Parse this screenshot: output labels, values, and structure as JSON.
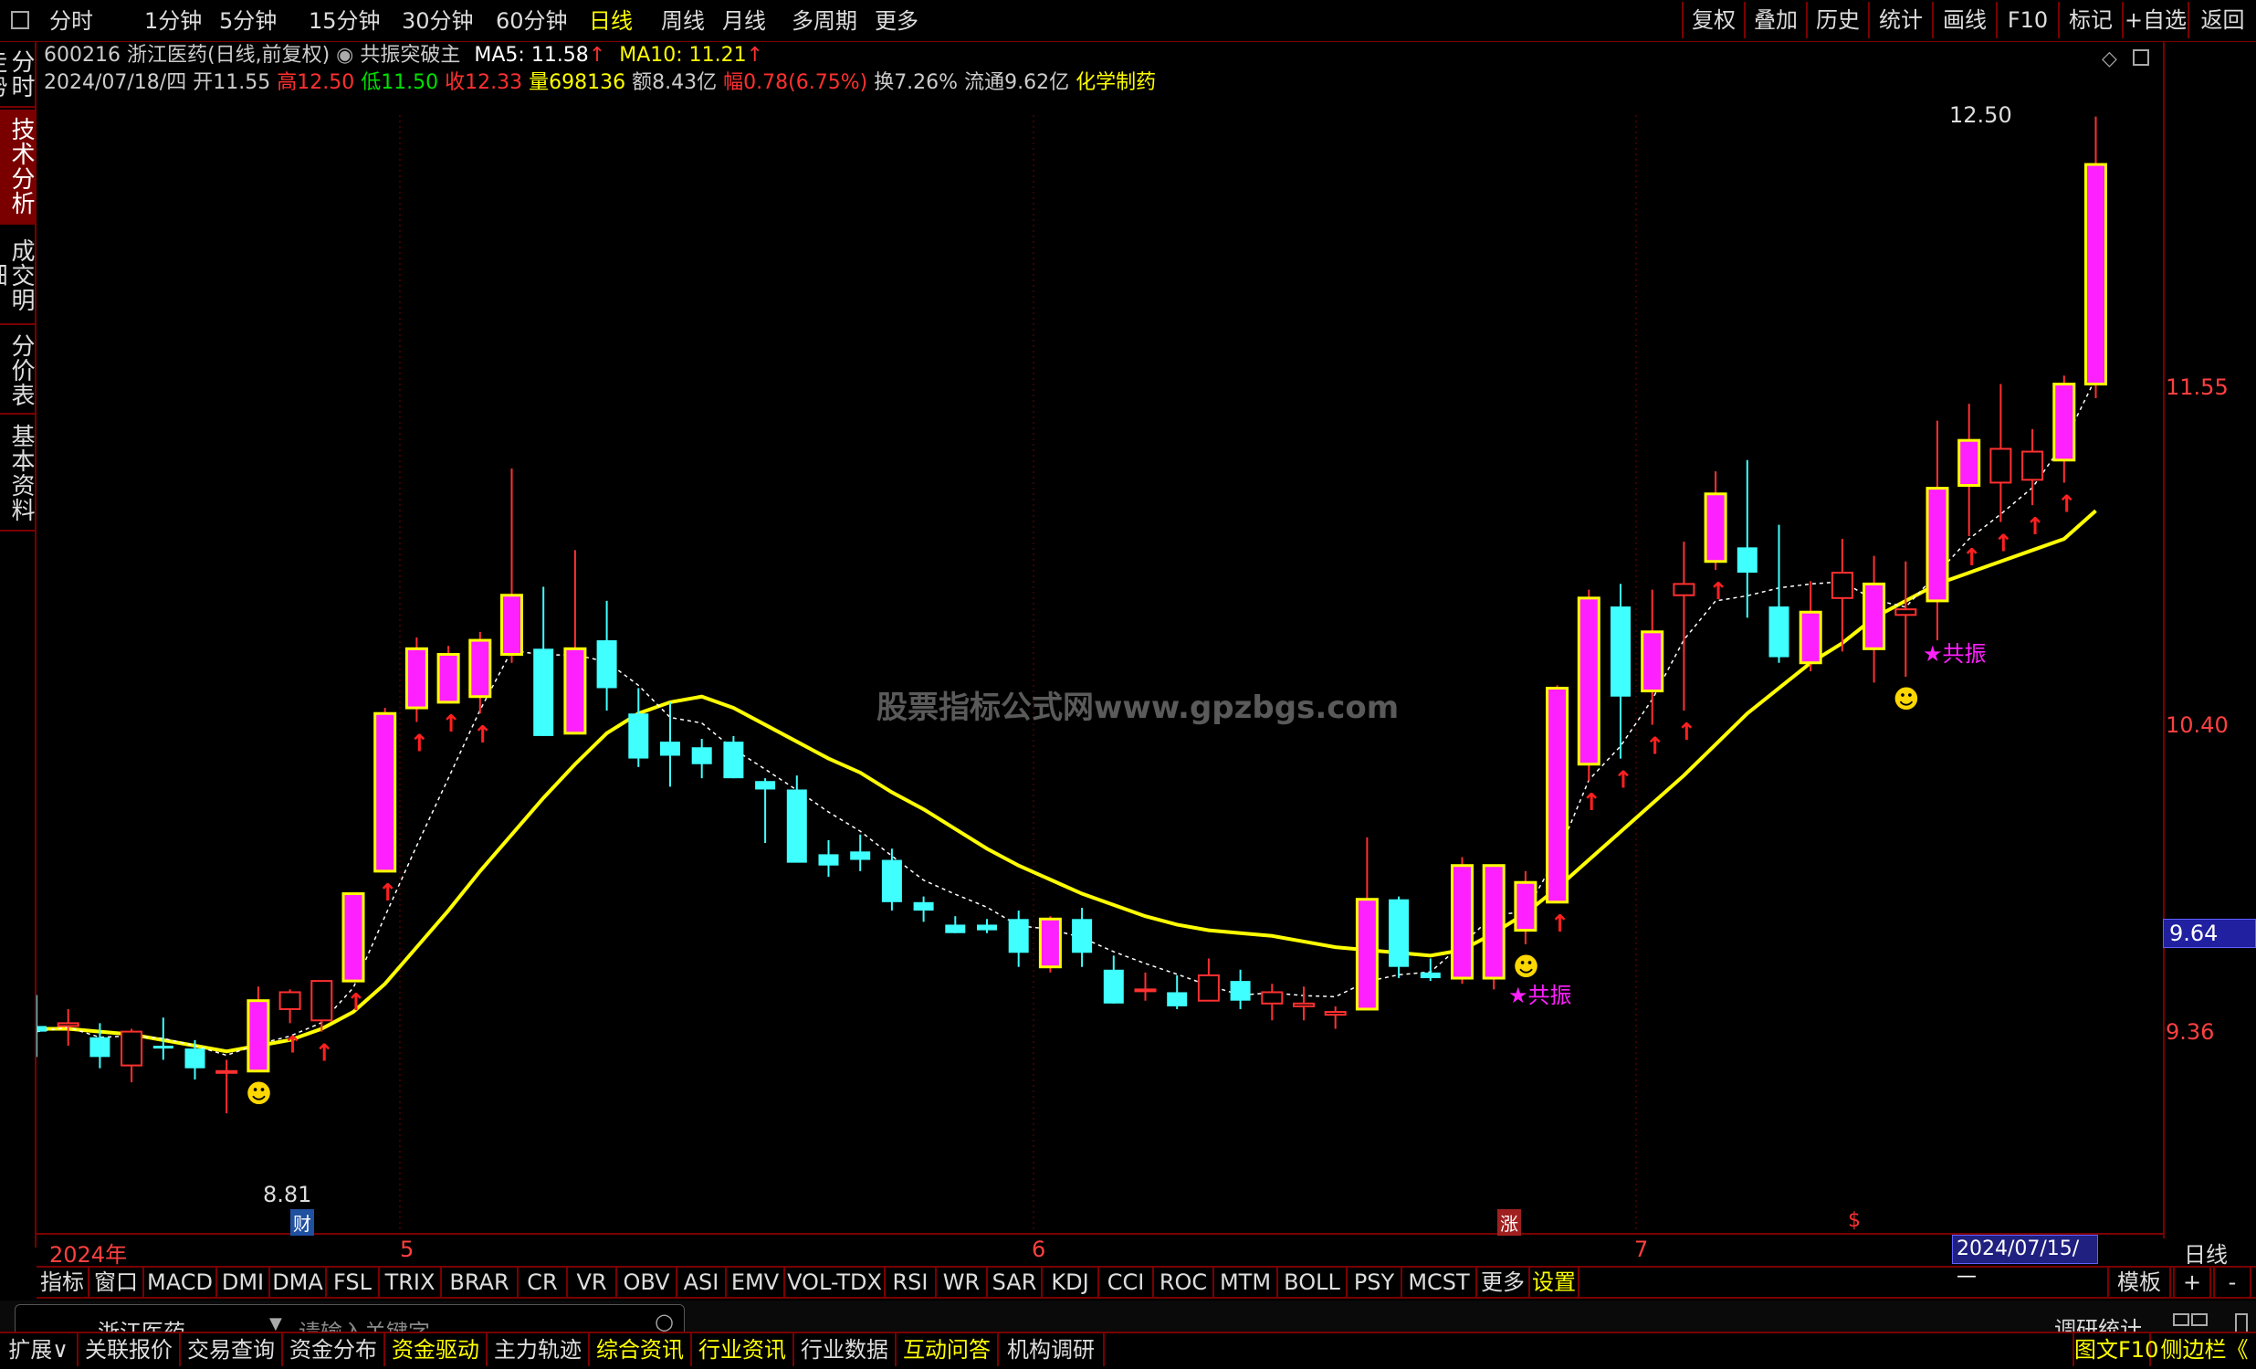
{
  "toolbar": {
    "periods": [
      "分时",
      "1分钟",
      "5分钟",
      "15分钟",
      "30分钟",
      "60分钟",
      "日线",
      "周线",
      "月线",
      "多周期",
      "更多"
    ],
    "active_period": "日线",
    "right_buttons": [
      "复权",
      "叠加",
      "历史",
      "统计",
      "画线",
      "F10",
      "标记",
      "+自选",
      "返回"
    ]
  },
  "left_tabs": [
    "分时走势",
    "技术分析",
    "成交明细",
    "分价表",
    "基本资料"
  ],
  "stock": {
    "code": "600216",
    "name": "浙江医药",
    "mode": "(日线,前复权)",
    "indicator_name": "共振突破主",
    "ma5_label": "MA5: 11.58",
    "ma10_label": "MA10: 11.21",
    "date": "2024/07/18/四",
    "open_label": "开11.55",
    "high_label": "高12.50",
    "low_label": "低11.50",
    "close_label": "收12.33",
    "volume_label": "量698136",
    "amount_label": "额8.43亿",
    "change_label": "幅0.78(6.75%)",
    "turnover_label": "换7.26%",
    "float_label": "流通9.62亿",
    "sector": "化学制药"
  },
  "price_axis": {
    "labels": [
      "11.55",
      "10.40",
      "9.36"
    ],
    "current_price_box": "9.64",
    "unit_label": "日线"
  },
  "date_axis": {
    "labels": [
      "2024年",
      "5",
      "6",
      "7"
    ],
    "cursor_date": "2024/07/15/—",
    "markers": {
      "cai": "财",
      "zhang": "涨",
      "dollar": "$"
    }
  },
  "annotations": {
    "high_price": "12.50",
    "low_price": "8.81",
    "gongzhen": "★共振",
    "watermark": "股票指标公式网www.gpzbgs.com"
  },
  "indicator_tabs": [
    "指标",
    "窗口",
    "MACD",
    "DMI",
    "DMA",
    "FSL",
    "TRIX",
    "BRAR",
    "CR",
    "VR",
    "OBV",
    "ASI",
    "EMV",
    "VOL-TDX",
    "RSI",
    "WR",
    "SAR",
    "KDJ",
    "CCI",
    "ROC",
    "MTM",
    "BOLL",
    "PSY",
    "MCST",
    "更多",
    "设置"
  ],
  "indicator_tabs_right": [
    "模板",
    "+",
    "-"
  ],
  "search": {
    "stock_name": "浙江医药",
    "placeholder": "请输入关键字",
    "right_label": "调研统计"
  },
  "bottom_tabs": [
    "扩展∨",
    "关联报价",
    "交易查询",
    "资金分布",
    "资金驱动",
    "主力轨迹",
    "综合资讯",
    "行业资讯",
    "行业数据",
    "互动问答",
    "机构调研"
  ],
  "bottom_right": [
    "图文F10",
    "侧边栏《"
  ],
  "colors": {
    "up": "#ff3030",
    "down": "#40ffff",
    "ma_line": "#ffff00",
    "accent_magenta": "#ff20ff",
    "border": "#7a0000"
  },
  "chart_data": {
    "type": "candlestick",
    "ylim": [
      8.6,
      12.7
    ],
    "series_ma": "MA10",
    "candles": [
      {
        "o": 9.27,
        "h": 9.38,
        "l": 9.16,
        "c": 9.25
      },
      {
        "o": 9.27,
        "h": 9.33,
        "l": 9.2,
        "c": 9.28
      },
      {
        "o": 9.23,
        "h": 9.28,
        "l": 9.12,
        "c": 9.16
      },
      {
        "o": 9.13,
        "h": 9.26,
        "l": 9.07,
        "c": 9.25
      },
      {
        "o": 9.2,
        "h": 9.3,
        "l": 9.15,
        "c": 9.19
      },
      {
        "o": 9.19,
        "h": 9.22,
        "l": 9.08,
        "c": 9.12
      },
      {
        "o": 9.11,
        "h": 9.15,
        "l": 8.96,
        "c": 9.11
      },
      {
        "o": 9.11,
        "h": 9.41,
        "l": 9.11,
        "c": 9.36
      },
      {
        "o": 9.33,
        "h": 9.4,
        "l": 9.28,
        "c": 9.39
      },
      {
        "o": 9.29,
        "h": 9.43,
        "l": 9.25,
        "c": 9.43
      },
      {
        "o": 9.43,
        "h": 9.74,
        "l": 9.43,
        "c": 9.74
      },
      {
        "o": 9.82,
        "h": 10.4,
        "l": 9.82,
        "c": 10.38
      },
      {
        "o": 10.4,
        "h": 10.65,
        "l": 10.35,
        "c": 10.61
      },
      {
        "o": 10.42,
        "h": 10.62,
        "l": 10.42,
        "c": 10.59
      },
      {
        "o": 10.44,
        "h": 10.67,
        "l": 10.38,
        "c": 10.64
      },
      {
        "o": 10.59,
        "h": 11.25,
        "l": 10.56,
        "c": 10.8
      },
      {
        "o": 10.61,
        "h": 10.83,
        "l": 10.3,
        "c": 10.3
      },
      {
        "o": 10.31,
        "h": 10.96,
        "l": 10.31,
        "c": 10.61
      },
      {
        "o": 10.64,
        "h": 10.78,
        "l": 10.39,
        "c": 10.47
      },
      {
        "o": 10.38,
        "h": 10.47,
        "l": 10.19,
        "c": 10.22
      },
      {
        "o": 10.28,
        "h": 10.42,
        "l": 10.12,
        "c": 10.23
      },
      {
        "o": 10.26,
        "h": 10.29,
        "l": 10.15,
        "c": 10.2
      },
      {
        "o": 10.28,
        "h": 10.3,
        "l": 10.15,
        "c": 10.15
      },
      {
        "o": 10.14,
        "h": 10.15,
        "l": 9.92,
        "c": 10.11
      },
      {
        "o": 10.11,
        "h": 10.16,
        "l": 9.87,
        "c": 9.85
      },
      {
        "o": 9.88,
        "h": 9.93,
        "l": 9.8,
        "c": 9.84
      },
      {
        "o": 9.89,
        "h": 9.95,
        "l": 9.82,
        "c": 9.86
      },
      {
        "o": 9.86,
        "h": 9.9,
        "l": 9.68,
        "c": 9.71
      },
      {
        "o": 9.71,
        "h": 9.73,
        "l": 9.64,
        "c": 9.68
      },
      {
        "o": 9.63,
        "h": 9.66,
        "l": 9.6,
        "c": 9.6
      },
      {
        "o": 9.63,
        "h": 9.65,
        "l": 9.6,
        "c": 9.61
      },
      {
        "o": 9.65,
        "h": 9.68,
        "l": 9.48,
        "c": 9.53
      },
      {
        "o": 9.48,
        "h": 9.66,
        "l": 9.46,
        "c": 9.65
      },
      {
        "o": 9.65,
        "h": 9.69,
        "l": 9.48,
        "c": 9.53
      },
      {
        "o": 9.47,
        "h": 9.52,
        "l": 9.35,
        "c": 9.35
      },
      {
        "o": 9.4,
        "h": 9.46,
        "l": 9.36,
        "c": 9.4
      },
      {
        "o": 9.39,
        "h": 9.45,
        "l": 9.33,
        "c": 9.34
      },
      {
        "o": 9.36,
        "h": 9.51,
        "l": 9.36,
        "c": 9.45
      },
      {
        "o": 9.43,
        "h": 9.47,
        "l": 9.33,
        "c": 9.36
      },
      {
        "o": 9.35,
        "h": 9.42,
        "l": 9.29,
        "c": 9.39
      },
      {
        "o": 9.34,
        "h": 9.41,
        "l": 9.29,
        "c": 9.35
      },
      {
        "o": 9.31,
        "h": 9.34,
        "l": 9.26,
        "c": 9.32
      },
      {
        "o": 9.33,
        "h": 9.94,
        "l": 9.33,
        "c": 9.72
      },
      {
        "o": 9.72,
        "h": 9.73,
        "l": 9.44,
        "c": 9.48
      },
      {
        "o": 9.46,
        "h": 9.51,
        "l": 9.43,
        "c": 9.44
      },
      {
        "o": 9.44,
        "h": 9.87,
        "l": 9.42,
        "c": 9.84
      },
      {
        "o": 9.44,
        "h": 9.84,
        "l": 9.4,
        "c": 9.84
      },
      {
        "o": 9.61,
        "h": 9.82,
        "l": 9.56,
        "c": 9.78
      },
      {
        "o": 9.71,
        "h": 10.48,
        "l": 9.71,
        "c": 10.47
      },
      {
        "o": 10.2,
        "h": 10.82,
        "l": 10.14,
        "c": 10.79
      },
      {
        "o": 10.76,
        "h": 10.84,
        "l": 10.22,
        "c": 10.44
      },
      {
        "o": 10.46,
        "h": 10.82,
        "l": 10.34,
        "c": 10.67
      },
      {
        "o": 10.8,
        "h": 10.99,
        "l": 10.39,
        "c": 10.84
      },
      {
        "o": 10.92,
        "h": 11.24,
        "l": 10.89,
        "c": 11.16
      },
      {
        "o": 10.97,
        "h": 11.28,
        "l": 10.72,
        "c": 10.88
      },
      {
        "o": 10.76,
        "h": 11.05,
        "l": 10.56,
        "c": 10.58
      },
      {
        "o": 10.56,
        "h": 10.85,
        "l": 10.53,
        "c": 10.74
      },
      {
        "o": 10.79,
        "h": 11.0,
        "l": 10.6,
        "c": 10.88
      },
      {
        "o": 10.61,
        "h": 10.94,
        "l": 10.49,
        "c": 10.84
      },
      {
        "o": 10.73,
        "h": 10.92,
        "l": 10.51,
        "c": 10.75
      },
      {
        "o": 10.78,
        "h": 11.42,
        "l": 10.64,
        "c": 11.18
      },
      {
        "o": 11.19,
        "h": 11.48,
        "l": 11.01,
        "c": 11.35
      },
      {
        "o": 11.2,
        "h": 11.55,
        "l": 11.06,
        "c": 11.32
      },
      {
        "o": 11.21,
        "h": 11.39,
        "l": 11.12,
        "c": 11.31
      },
      {
        "o": 11.28,
        "h": 11.58,
        "l": 11.2,
        "c": 11.55
      },
      {
        "o": 11.55,
        "h": 12.5,
        "l": 11.5,
        "c": 12.33
      }
    ],
    "ma10": [
      9.26,
      9.26,
      9.25,
      9.24,
      9.22,
      9.2,
      9.18,
      9.2,
      9.22,
      9.26,
      9.32,
      9.42,
      9.55,
      9.68,
      9.82,
      9.95,
      10.08,
      10.2,
      10.31,
      10.38,
      10.42,
      10.44,
      10.4,
      10.34,
      10.28,
      10.22,
      10.17,
      10.1,
      10.04,
      9.97,
      9.9,
      9.84,
      9.79,
      9.74,
      9.7,
      9.66,
      9.63,
      9.61,
      9.6,
      9.59,
      9.57,
      9.55,
      9.54,
      9.53,
      9.52,
      9.54,
      9.6,
      9.67,
      9.76,
      9.86,
      9.96,
      10.06,
      10.16,
      10.27,
      10.38,
      10.47,
      10.56,
      10.63,
      10.72,
      10.78,
      10.84,
      10.88,
      10.92,
      10.96,
      11.0,
      11.1
    ]
  }
}
